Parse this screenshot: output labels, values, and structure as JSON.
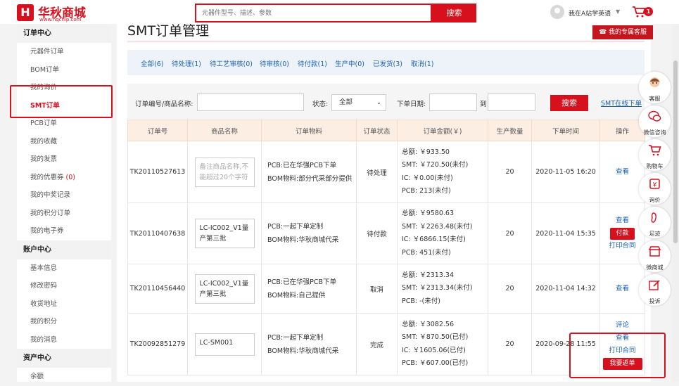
{
  "header": {
    "logo_mark": "H",
    "logo_name": "华秋商城",
    "logo_url": "www.hqchip.com",
    "search_placeholder": "元器件型号、描述、参数",
    "search_button": "搜索",
    "user_name": "我在A站学英语",
    "user_caret": "▼",
    "cart_count": "1"
  },
  "sidebar": {
    "sections": [
      {
        "title": "订单中心",
        "items": [
          "元器件订单",
          "BOM订单",
          "我的询价",
          "SMT订单",
          "PCB订单",
          "我的收藏",
          "我的发票",
          "我的优惠券",
          "我的中奖记录",
          "我的积分订单",
          "我的电子券"
        ]
      },
      {
        "title": "账户中心",
        "items": [
          "基本信息",
          "修改密码",
          "收货地址",
          "我的积分",
          "我的消息"
        ]
      },
      {
        "title": "资产中心",
        "items": [
          "余额"
        ]
      }
    ],
    "coupon_count": "(0)",
    "active_item": "SMT订单"
  },
  "main": {
    "title": "SMT订单管理",
    "service_button": "我的专属客服",
    "tabs": [
      "全部(6)",
      "待处理(1)",
      "待工艺审核(0)",
      "待审核(0)",
      "待付款(1)",
      "生产中(0)",
      "已发货(3)",
      "取消(1)"
    ],
    "filter": {
      "order_label": "订单编号/商品名称:",
      "status_label": "状态:",
      "status_value": "全部",
      "date_label": "下单日期:",
      "date_to": "到",
      "search_button": "搜索",
      "smt_online_link": "SMT在线下单"
    },
    "table": {
      "headers": [
        "订单号",
        "商品名称",
        "订单物料",
        "订单状态",
        "订单金额(￥)",
        "生产数量",
        "下单时间",
        "操作"
      ],
      "rows": [
        {
          "order_no": "TK20110527613",
          "product": "备注商品名称,不能超过20个字符",
          "product_placeholder": true,
          "pcb": "PCB:已在华强PCB下单",
          "bom": "BOM物料:部分代采部分提供",
          "status": "待处理",
          "total": "总额: ￥933.50",
          "smt": "SMT: ￥720.50(未付)",
          "ic": "IC: ￥0.00(未付)",
          "pcb_amt": "PCB: 213(未付)",
          "qty": "20",
          "time": "2020-11-05 16:20",
          "ops": [
            "查看"
          ]
        },
        {
          "order_no": "TK20110407638",
          "product": "LC-IC002_V1量产第三批",
          "product_placeholder": false,
          "pcb": "PCB:一起下单定制",
          "bom": "BOM物料:华秋商城代采",
          "status": "待付款",
          "total": "总额: ￥9580.63",
          "smt": "SMT: ￥2263.48(未付)",
          "ic": "IC: ￥6866.15(未付)",
          "pcb_amt": "PCB: 451(未付)",
          "qty": "20",
          "time": "2020-11-04 15:35",
          "ops": [
            "查看",
            "付款",
            "打印合同"
          ]
        },
        {
          "order_no": "TK20110456440",
          "product": "LC-IC002_V1量产第三批",
          "product_placeholder": false,
          "pcb": "PCB:已在华强PCB下单",
          "bom": "BOM物料:自己提供",
          "status": "取消",
          "total": "总额: ￥2313.34",
          "smt": "SMT: ￥2313.34(未付)",
          "ic": "",
          "pcb_amt": "PCB: -(未付)",
          "qty": "20",
          "time": "2020-11-04 14:32",
          "ops": [
            "查看"
          ]
        },
        {
          "order_no": "TK20092851279",
          "product": "LC-SM001",
          "product_placeholder": false,
          "pcb": "PCB:一起下单定制",
          "bom": "BOM物料:华秋商城代采",
          "status": "完成",
          "total": "总额: ￥3082.56",
          "smt": "SMT: ￥870.50(已付)",
          "ic": "IC: ￥1605.06(已付)",
          "pcb_amt": "PCB: ￥607.00(已付)",
          "qty": "20",
          "time": "2020-09-28 11:55",
          "ops": [
            "评论",
            "查看",
            "打印合同",
            "我要返单"
          ]
        }
      ]
    }
  },
  "right_bar": [
    "客服",
    "微信咨询",
    "购物车",
    "询价",
    "足迹",
    "微商城",
    "投诉"
  ],
  "colors": {
    "accent": "#d6111d",
    "link": "#1a63b4",
    "header_row": "#fdeee4",
    "tab_bar": "#eef3fa"
  }
}
